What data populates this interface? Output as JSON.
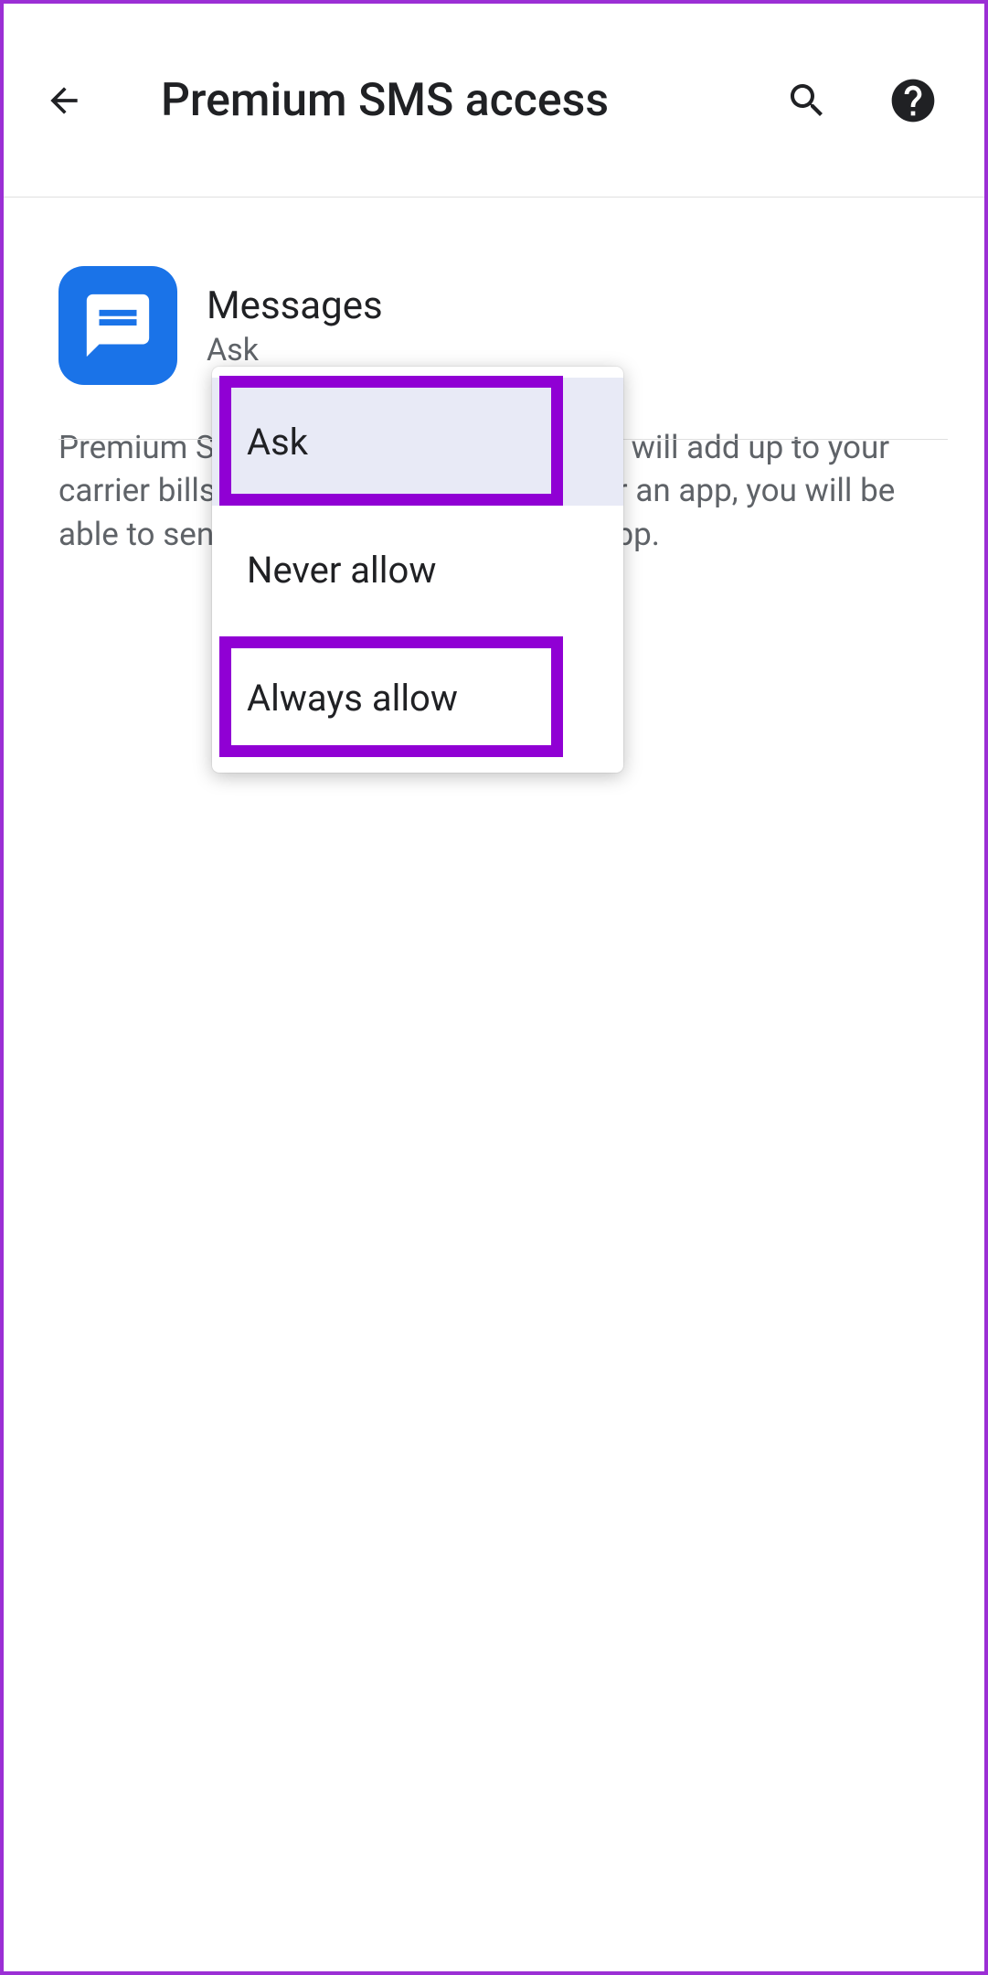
{
  "header": {
    "title": "Premium SMS access"
  },
  "app": {
    "name": "Messages",
    "status": "Ask"
  },
  "description": "Premium SMS may cost you money and will add up to your carrier bills. If you enable permission for an app, you will be able to send premium SMS using that app.",
  "dropdown": {
    "options": [
      "Ask",
      "Never allow",
      "Always allow"
    ]
  }
}
